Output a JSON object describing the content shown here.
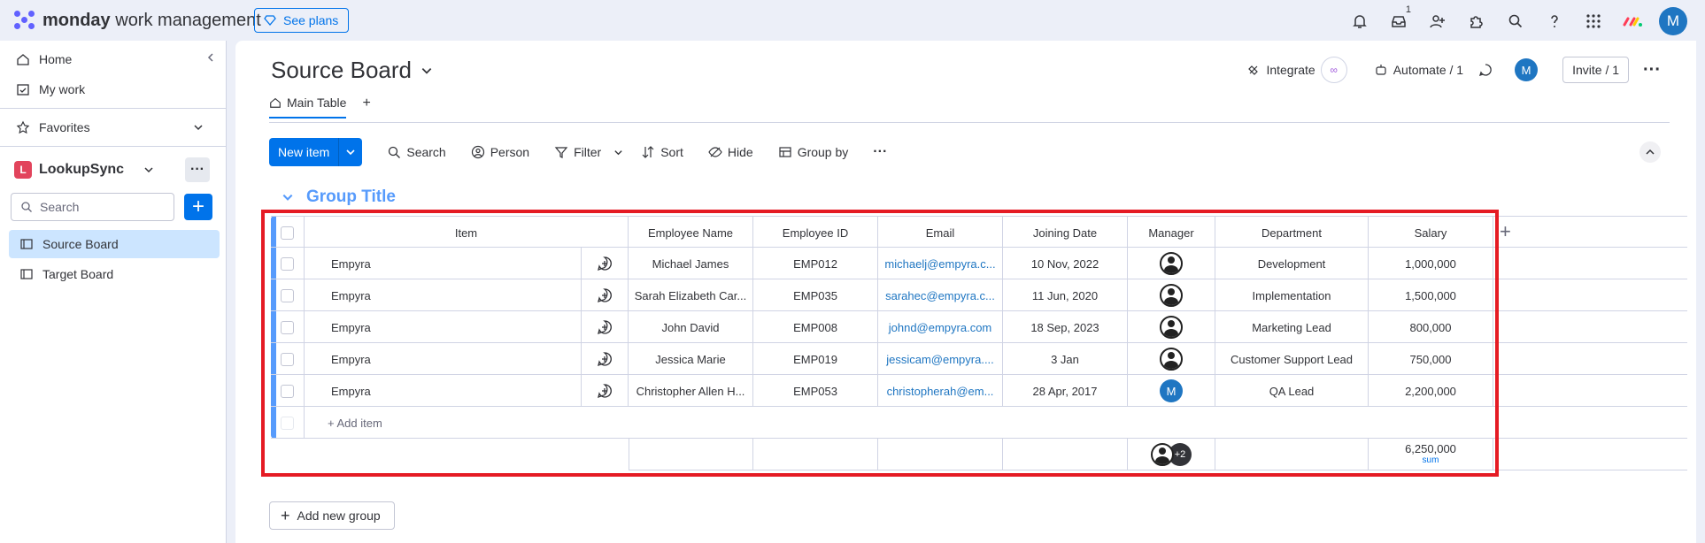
{
  "topbar": {
    "brand_bold": "monday",
    "brand_rest": " work management",
    "see_plans": "See plans",
    "inbox_badge": "1",
    "avatar_initial": "M"
  },
  "sidebar": {
    "home": "Home",
    "my_work": "My work",
    "favorites": "Favorites",
    "workspace_initial": "L",
    "workspace_name": "LookupSync",
    "search_placeholder": "Search",
    "boards": [
      "Source Board",
      "Target Board"
    ]
  },
  "board": {
    "title": "Source Board",
    "integrate": "Integrate",
    "automate": "Automate / 1",
    "avatar_initial": "M",
    "invite": "Invite / 1",
    "tab_main": "Main Table",
    "tab_add": "+"
  },
  "toolbar": {
    "new_item": "New item",
    "search": "Search",
    "person": "Person",
    "filter": "Filter",
    "sort": "Sort",
    "hide": "Hide",
    "group_by": "Group by"
  },
  "group": {
    "title": "Group Title",
    "columns": [
      "Item",
      "Employee Name",
      "Employee ID",
      "Email",
      "Joining Date",
      "Manager",
      "Department",
      "Salary"
    ],
    "rows": [
      {
        "item": "Empyra",
        "name": "Michael James",
        "id": "EMP012",
        "email": "michaelj@empyra.c...",
        "date": "10 Nov, 2022",
        "manager": "person",
        "dept": "Development",
        "salary": "1,000,000"
      },
      {
        "item": "Empyra",
        "name": "Sarah Elizabeth Car...",
        "id": "EMP035",
        "email": "sarahec@empyra.c...",
        "date": "11 Jun, 2020",
        "manager": "person",
        "dept": "Implementation",
        "salary": "1,500,000"
      },
      {
        "item": "Empyra",
        "name": "John David",
        "id": "EMP008",
        "email": "johnd@empyra.com",
        "date": "18 Sep, 2023",
        "manager": "person",
        "dept": "Marketing Lead",
        "salary": "800,000"
      },
      {
        "item": "Empyra",
        "name": "Jessica Marie",
        "id": "EMP019",
        "email": "jessicam@empyra....",
        "date": "3 Jan",
        "manager": "person",
        "dept": "Customer Support Lead",
        "salary": "750,000"
      },
      {
        "item": "Empyra",
        "name": "Christopher Allen H...",
        "id": "EMP053",
        "email": "christopherah@em...",
        "date": "28 Apr, 2017",
        "manager": "M",
        "dept": "QA Lead",
        "salary": "2,200,000"
      }
    ],
    "add_item": "+ Add item",
    "summary_manager_more": "+2",
    "summary_salary": "6,250,000",
    "summary_salary_label": "sum"
  },
  "add_new_group": "Add new group",
  "colors": {
    "accent": "#0073ea",
    "group": "#579bfc",
    "highlight": "#e51b24"
  }
}
